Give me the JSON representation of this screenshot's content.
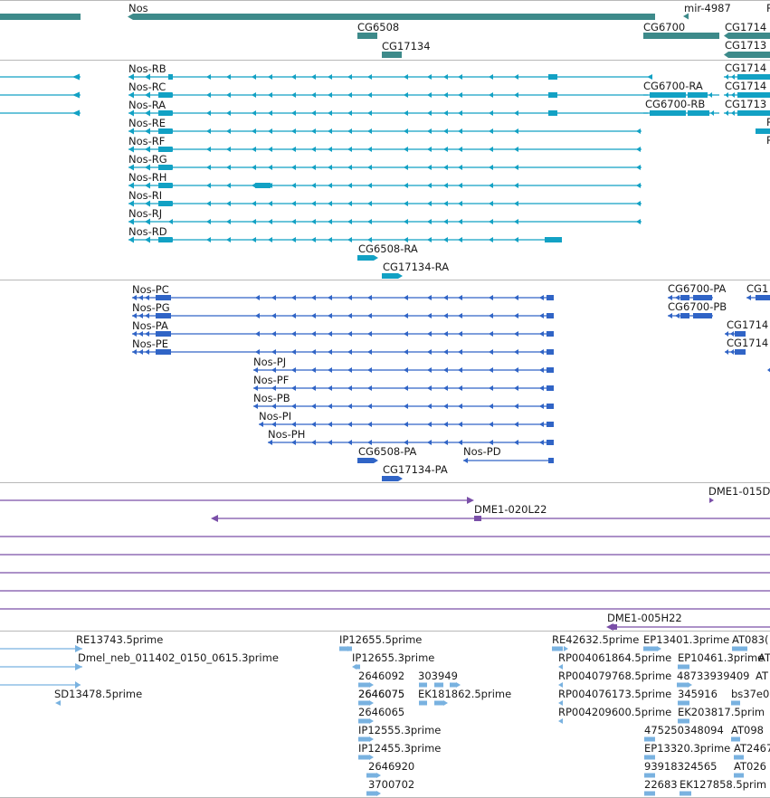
{
  "colors": {
    "gene": "#3d8a8a",
    "transcript": "#12a1c4",
    "cds": "#3064c6",
    "clone": "#7a4fa8",
    "est": "#79b2e0",
    "divider": "#b8b8b8",
    "text": "#1a1a1a"
  },
  "tracks": {
    "genes": {
      "features": [
        {
          "label": ""
        },
        {
          "label": "Nos"
        },
        {
          "label": "mir-4987"
        },
        {
          "label": "CG6508"
        },
        {
          "label": "CG6700"
        },
        {
          "label": "CG1714"
        },
        {
          "label": "CG17134"
        },
        {
          "label": "CG1713"
        },
        {
          "label": "R"
        }
      ]
    },
    "transcripts": {
      "features": [
        {
          "label": "Nos-RB"
        },
        {
          "label": "Nos-RC"
        },
        {
          "label": "Nos-RA"
        },
        {
          "label": "Nos-RE"
        },
        {
          "label": "Nos-RF"
        },
        {
          "label": "Nos-RG"
        },
        {
          "label": "Nos-RH"
        },
        {
          "label": "Nos-RI"
        },
        {
          "label": "Nos-RJ"
        },
        {
          "label": "Nos-RD"
        },
        {
          "label": "CG6700-RA"
        },
        {
          "label": "CG6700-RB"
        },
        {
          "label": "CG1714"
        },
        {
          "label": "CG1714"
        },
        {
          "label": "CG1713"
        },
        {
          "label": "R"
        },
        {
          "label": "R"
        },
        {
          "label": "CG6508-RA"
        },
        {
          "label": "CG17134-RA"
        }
      ]
    },
    "proteins": {
      "features": [
        {
          "label": "Nos-PC"
        },
        {
          "label": "Nos-PG"
        },
        {
          "label": "Nos-PA"
        },
        {
          "label": "Nos-PE"
        },
        {
          "label": "Nos-PJ"
        },
        {
          "label": "Nos-PF"
        },
        {
          "label": "Nos-PB"
        },
        {
          "label": "Nos-PI"
        },
        {
          "label": "Nos-PH"
        },
        {
          "label": "CG6508-PA"
        },
        {
          "label": "Nos-PD"
        },
        {
          "label": "CG17134-PA"
        },
        {
          "label": "CG6700-PA"
        },
        {
          "label": "CG6700-PB"
        },
        {
          "label": "CG1"
        },
        {
          "label": "CG1714"
        },
        {
          "label": "CG1714"
        }
      ]
    },
    "clones": {
      "features": [
        {
          "label": "DME1-015D"
        },
        {
          "label": "DME1-020L22"
        },
        {
          "label": "DME1-005H22"
        }
      ]
    },
    "ests": {
      "features": [
        {
          "label": "RE13743.5prime"
        },
        {
          "label": "Dmel_neb_011402_0150_0615.3prime"
        },
        {
          "label": "SD13478.5prime"
        },
        {
          "label": "IP12655.5prime"
        },
        {
          "label": "IP12655.3prime"
        },
        {
          "label": "2646092"
        },
        {
          "label": "303949"
        },
        {
          "label": "2646075"
        },
        {
          "label": "EK181862.5prime"
        },
        {
          "label": "2646065"
        },
        {
          "label": "IP12555.3prime"
        },
        {
          "label": "IP12455.3prime"
        },
        {
          "label": "2646920"
        },
        {
          "label": "3700702"
        },
        {
          "label": "RE42632.5prime"
        },
        {
          "label": "EP13401.3prime"
        },
        {
          "label": "AT083("
        },
        {
          "label": "RP004061864.5prime"
        },
        {
          "label": "EP10461.3prime"
        },
        {
          "label": "RP004079768.5prime"
        },
        {
          "label": "48733939409"
        },
        {
          "label": "AT"
        },
        {
          "label": "RP004076173.5prime"
        },
        {
          "label": "345916"
        },
        {
          "label": "bs37e0"
        },
        {
          "label": "RP004209600.5prime"
        },
        {
          "label": "EK203817.5prim"
        },
        {
          "label": "475250348094"
        },
        {
          "label": "AT098"
        },
        {
          "label": "EP13320.3prime"
        },
        {
          "label": "AT2467"
        },
        {
          "label": "93918324565"
        },
        {
          "label": "AT026"
        },
        {
          "label": "22683"
        },
        {
          "label": "EK127858.5prim"
        },
        {
          "label": "AT"
        }
      ]
    }
  }
}
